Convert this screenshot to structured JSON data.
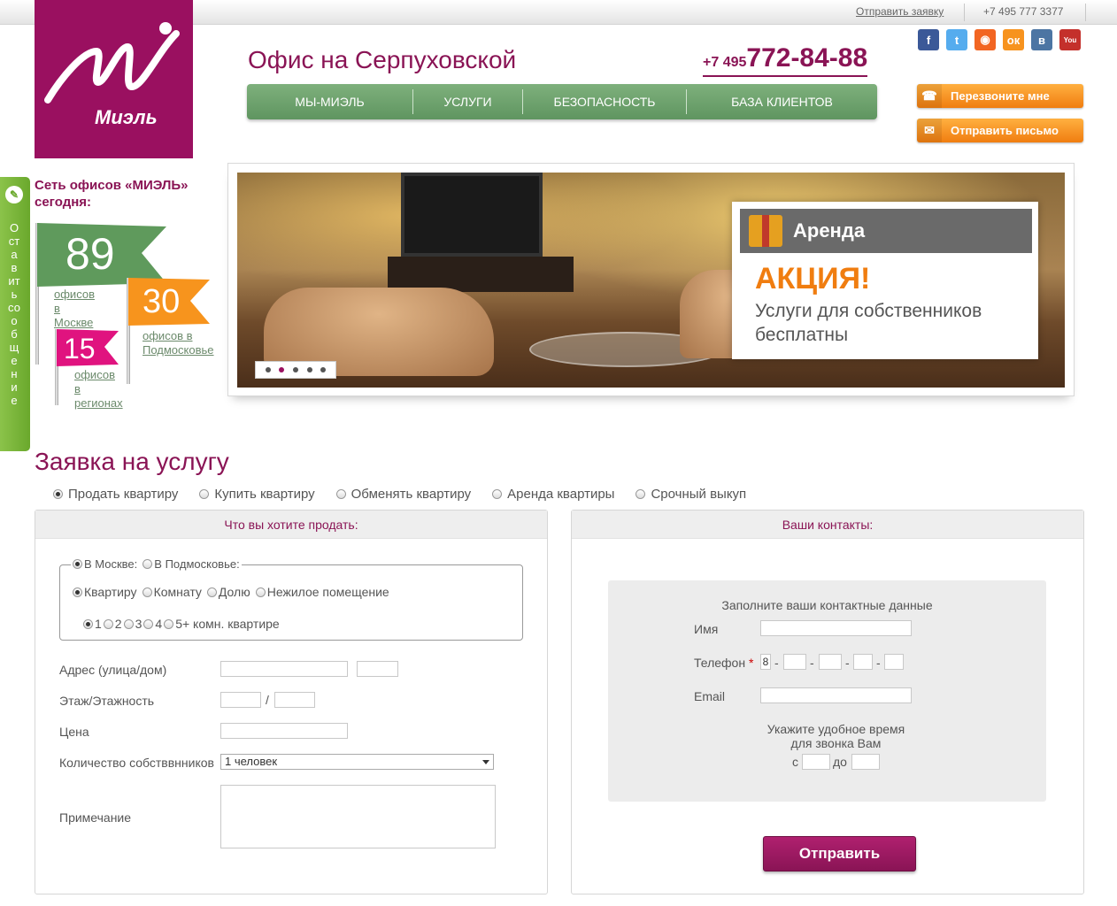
{
  "topbar": {
    "request_link": "Отправить заявку",
    "phone": "+7 495 777 3377"
  },
  "logo": {
    "brand": "Миэль"
  },
  "header": {
    "office_title": "Офис на Серпуховской",
    "phone_prefix": "+7 495",
    "phone_number": "772-84-88"
  },
  "nav": {
    "items": [
      "МЫ-МИЭЛЬ",
      "УСЛУГИ",
      "БЕЗОПАСНОСТЬ",
      "БАЗА КЛИЕНТОВ"
    ]
  },
  "social": [
    "facebook-icon",
    "twitter-icon",
    "rss-icon",
    "odnoklassniki-icon",
    "vkontakte-icon",
    "youtube-icon"
  ],
  "actions": {
    "callback": "Перезвоните мне",
    "send_letter": "Отправить письмо"
  },
  "sidetab": {
    "label": "Оставить сообщение"
  },
  "offices": {
    "title": "Сеть офисов «МИЭЛЬ» сегодня:",
    "moscow": {
      "count": "89",
      "label1": "офисов",
      "label2": "в Москве",
      "color": "#5f9a5c"
    },
    "region_mo": {
      "count": "30",
      "label1": "офисов в",
      "label2": "Подмосковье",
      "color": "#f7941d"
    },
    "regions": {
      "count": "15",
      "label1": "офисов",
      "label2": "в регионах",
      "color": "#e0137f"
    }
  },
  "banner": {
    "category": "Аренда",
    "headline": "АКЦИЯ!",
    "text": "Услуги для собственников бесплатны",
    "active_slide": 2,
    "slides": 5
  },
  "form": {
    "title": "Заявка на услугу",
    "services": [
      {
        "label": "Продать квартиру",
        "selected": true
      },
      {
        "label": "Купить квартиру",
        "selected": false
      },
      {
        "label": "Обменять квартиру",
        "selected": false
      },
      {
        "label": "Аренда квартиры",
        "selected": false
      },
      {
        "label": "Срочный выкуп",
        "selected": false
      }
    ],
    "left": {
      "heading": "Что вы хотите продать:",
      "location": {
        "moscow": "В Москве:",
        "mo": "В Подмосковье:"
      },
      "types": [
        "Квартиру",
        "Комнату",
        "Долю",
        "Нежилое помещение"
      ],
      "rooms": [
        "1",
        "2",
        "3",
        "4",
        "5+ комн. квартире"
      ],
      "address_label": "Адрес (улица/дом)",
      "floor_label": "Этаж/Этажность",
      "floor_sep": "/",
      "price_label": "Цена",
      "owners_label": "Количество собстввнников",
      "owners_value": "1 человек",
      "note_label": "Примечание"
    },
    "right": {
      "heading": "Ваши контакты:",
      "box_title": "Заполните ваши контактные данные",
      "name_label": "Имя",
      "phone_label": "Телефон",
      "required_mark": "*",
      "phone_prefix": "8",
      "email_label": "Email",
      "time_label_1": "Укажите удобное время",
      "time_label_2": "для звонка Вам",
      "from": "с",
      "to": "до",
      "submit": "Отправить"
    }
  }
}
